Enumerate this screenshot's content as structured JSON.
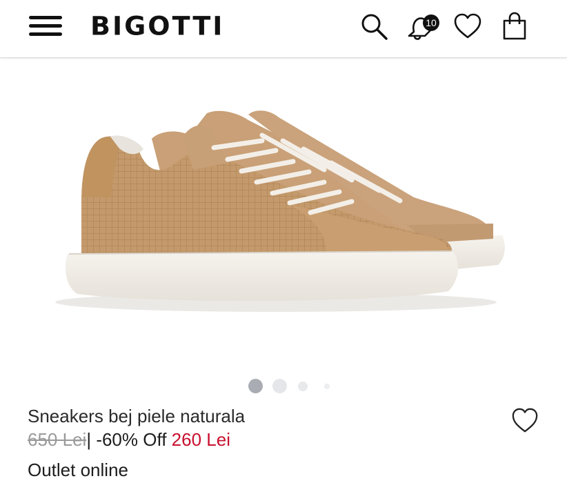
{
  "header": {
    "brand": "BIGOTTI",
    "notifications_count": "10",
    "icons": [
      "menu-icon",
      "search-icon",
      "bell-icon",
      "heart-icon",
      "shopping-bag-icon"
    ]
  },
  "product": {
    "image_alt_icon": "sneaker-image",
    "carousel": {
      "total": 4,
      "active": 1
    },
    "title": "Sneakers bej piele naturala",
    "old_price": "650 Lei",
    "separator": "|",
    "discount": "-60% Off",
    "new_price": "260 Lei",
    "tag": "Outlet online"
  },
  "colors": {
    "sale_red": "#c8102e",
    "old_price_gray": "#9a9a9a",
    "active_dot": "#a9adb3",
    "shoe_tan": "#c49a6c"
  }
}
